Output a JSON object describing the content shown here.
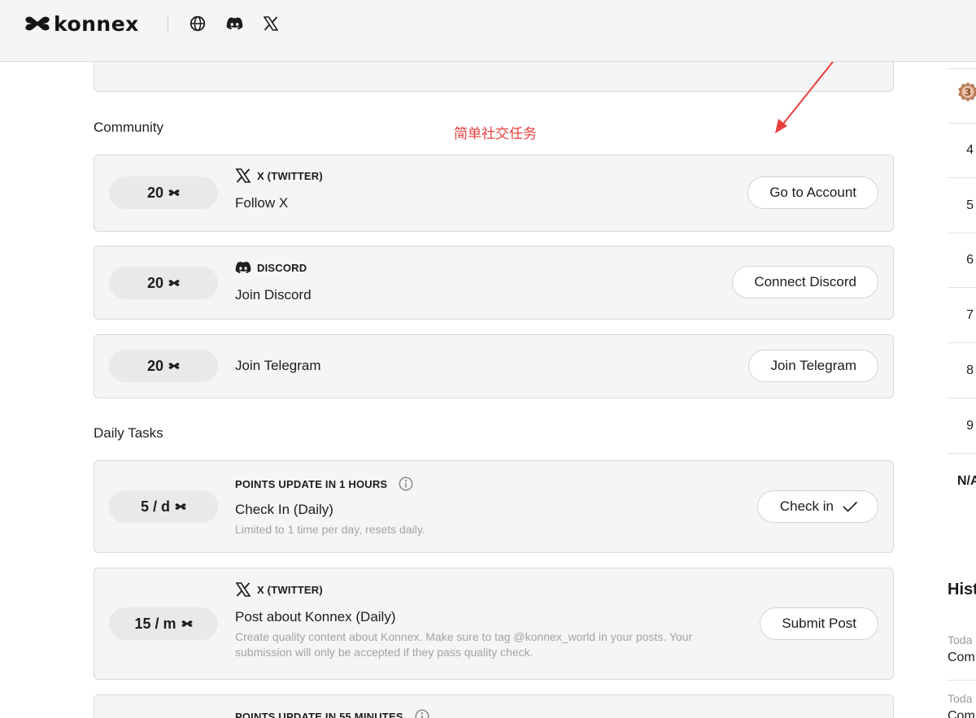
{
  "header": {
    "logo_text": "konnex",
    "icons": [
      "globe-icon",
      "discord-icon",
      "x-icon"
    ]
  },
  "annotation": {
    "text": "简单社交任务",
    "color": "#e8403e"
  },
  "community": {
    "title": "Community",
    "tasks": [
      {
        "points": "20",
        "platform": "X (TWITTER)",
        "title": "Follow X",
        "button": "Go to Account"
      },
      {
        "points": "20",
        "platform": "DISCORD",
        "title": "Join Discord",
        "button": "Connect Discord"
      },
      {
        "points": "20",
        "title": "Join Telegram",
        "button": "Join Telegram"
      }
    ]
  },
  "daily": {
    "title": "Daily Tasks",
    "tasks": [
      {
        "points": "5 / d",
        "status": "POINTS UPDATE IN 1 HOURS",
        "title": "Check In (Daily)",
        "desc": "Limited to 1 time per day, resets daily.",
        "button": "Check in"
      },
      {
        "points": "15 / m",
        "platform": "X (TWITTER)",
        "title": "Post about Konnex (Daily)",
        "desc": "Create quality content about Konnex. Make sure to tag @konnex_world in your posts. Your submission will only be accepted if they pass quality check.",
        "button": "Submit Post"
      },
      {
        "status": "POINTS UPDATE IN 55 MINUTES"
      }
    ]
  },
  "leaderboard": {
    "badge_rank": "3",
    "ranks": [
      "4",
      "5",
      "6",
      "7",
      "8",
      "9"
    ],
    "na_label": "N/A"
  },
  "history": {
    "title": "Hist",
    "entries": [
      {
        "date": "Toda",
        "text": "Com"
      },
      {
        "date": "Toda",
        "text": "Com"
      }
    ]
  }
}
